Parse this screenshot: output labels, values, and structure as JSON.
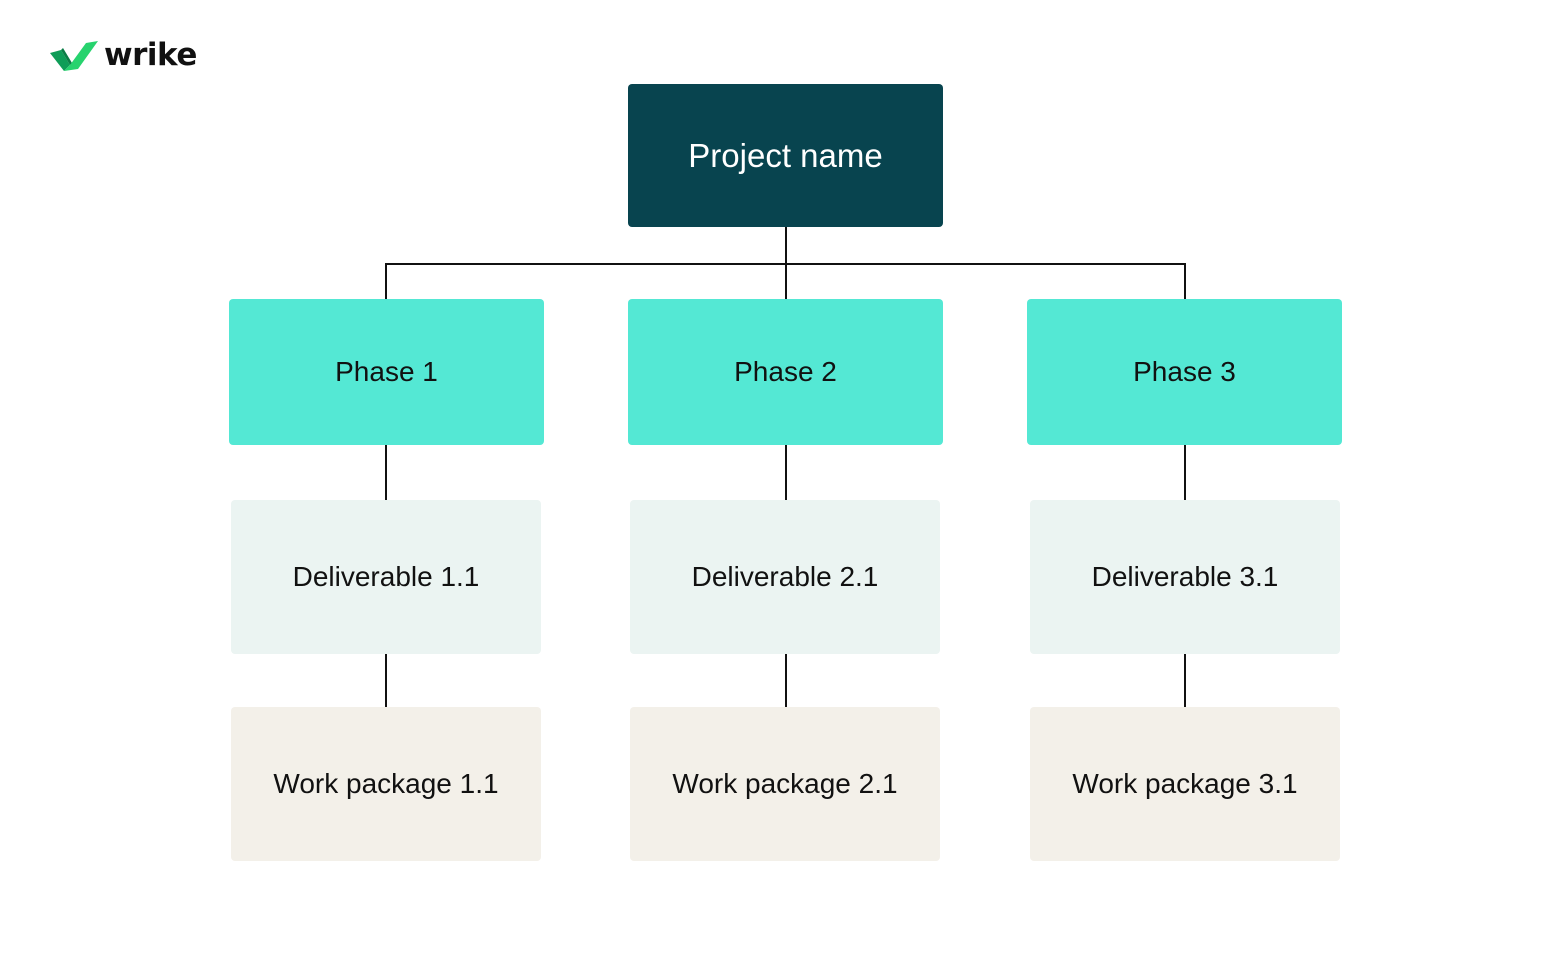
{
  "brand": {
    "logo_icon": "wrike-checkmark-icon",
    "name": "wrike",
    "colors": {
      "check_dark": "#0f9d58",
      "check_light": "#27d36e"
    }
  },
  "diagram": {
    "type": "work-breakdown-structure",
    "colors": {
      "root_fill": "#08444f",
      "root_text": "#ffffff",
      "phase_fill": "#54e8d4",
      "deliverable_fill": "#ebf4f2",
      "work_package_fill": "#f3f0e9",
      "connector": "#111111"
    },
    "root": {
      "label": "Project name"
    },
    "phases": [
      {
        "label": "Phase 1",
        "deliverable": "Deliverable 1.1",
        "work_package": "Work package 1.1"
      },
      {
        "label": "Phase 2",
        "deliverable": "Deliverable 2.1",
        "work_package": "Work package 2.1"
      },
      {
        "label": "Phase 3",
        "deliverable": "Deliverable 3.1",
        "work_package": "Work package 3.1"
      }
    ]
  }
}
